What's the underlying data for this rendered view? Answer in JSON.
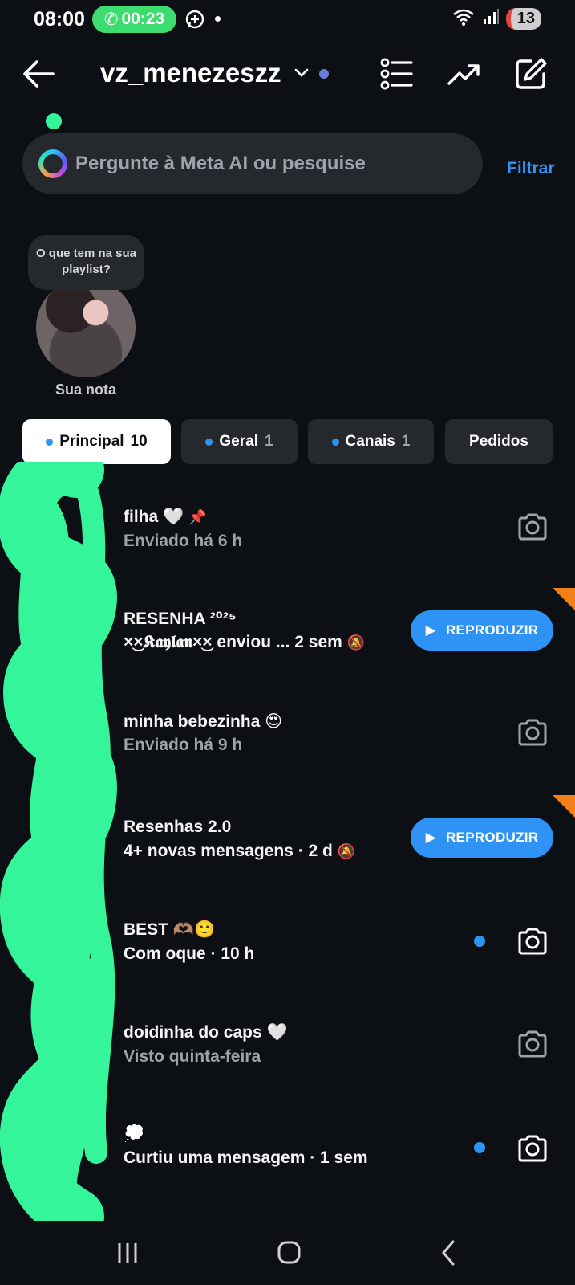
{
  "status_bar": {
    "time": "08:00",
    "call_duration": "00:23",
    "battery": "13"
  },
  "header": {
    "username": "vz_menezeszz"
  },
  "search": {
    "placeholder": "Pergunte à Meta AI ou pesquise",
    "filter_label": "Filtrar"
  },
  "note": {
    "bubble_text": "O que tem na sua playlist?",
    "label": "Sua nota"
  },
  "tabs": [
    {
      "label": "Principal",
      "count": "10",
      "active": true
    },
    {
      "label": "Geral",
      "count": "1",
      "active": false
    },
    {
      "label": "Canais",
      "count": "1",
      "active": false
    },
    {
      "label": "Pedidos",
      "count": "",
      "active": false
    }
  ],
  "chats": [
    {
      "title": "filha 🤍",
      "subtitle": "Enviado há 6 h",
      "pinned": true,
      "unread": false,
      "action": "camera"
    },
    {
      "title": "RESENHA ²⁰²⁵",
      "subtitle": "×͜×𝕶𝖆𝖞𝖑𝖆𝖓×͜× enviou ... 2 sem",
      "muted": true,
      "unread": true,
      "action": "REPRODUZIR"
    },
    {
      "title": "minha bebezinha 😍",
      "subtitle": "Enviado há 9 h",
      "unread": false,
      "action": "camera"
    },
    {
      "title": "Resenhas 2.0",
      "subtitle": "4+ novas mensagens · 2 d",
      "muted": true,
      "unread": true,
      "action": "REPRODUZIR"
    },
    {
      "title": "BEST 🫶🏽🙂",
      "subtitle": "Com oque · 10 h",
      "unread": true,
      "action": "camera"
    },
    {
      "title": "doidinha do caps 🤍",
      "subtitle": "Visto quinta-feira",
      "unread": false,
      "action": "camera"
    },
    {
      "title": "💭",
      "subtitle": "Curtiu uma mensagem · 1 sem",
      "unread": true,
      "action": "camera"
    }
  ],
  "colors": {
    "background": "#0c1014",
    "accent": "#2e93f5",
    "surface": "#25292e",
    "scribble": "#35f59b",
    "corner_badge": "#f57f17"
  }
}
